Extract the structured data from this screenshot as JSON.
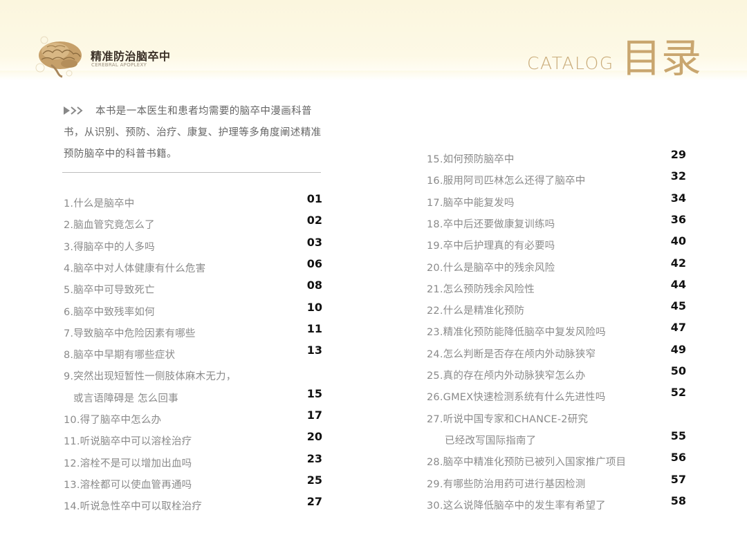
{
  "header": {
    "brand_title": "精准防治脑卒中",
    "brand_subtitle": "CEREBRAL APOPLEXY",
    "catalog_en": "CATALOG",
    "catalog_cn": "目录"
  },
  "intro": {
    "text": "本书是一本医生和患者均需要的脑卒中漫画科普书，从识别、预防、治疗、康复、护理等多角度阐述精准预防脑卒中的科普书籍。"
  },
  "toc_left": [
    {
      "title": "1.什么是脑卒中",
      "page": "01"
    },
    {
      "title": "2.脑血管究竟怎么了",
      "page": "02"
    },
    {
      "title": "3.得脑卒中的人多吗",
      "page": "03"
    },
    {
      "title": "4.脑卒中对人体健康有什么危害",
      "page": "06"
    },
    {
      "title": "5.脑卒中可导致死亡",
      "page": "08"
    },
    {
      "title": "6.脑卒中致残率如何",
      "page": "10"
    },
    {
      "title": "7.导致脑卒中危险因素有哪些",
      "page": "11"
    },
    {
      "title": "8.脑卒中早期有哪些症状",
      "page": "13"
    },
    {
      "title": "9.突然出现短暂性一侧肢体麻木无力，",
      "title2": "或言语障碍是 怎么回事",
      "page": "15"
    },
    {
      "title": "10.得了脑卒中怎么办",
      "page": "17"
    },
    {
      "title": "11.听说脑卒中可以溶栓治疗",
      "page": "20"
    },
    {
      "title": "12.溶栓不是可以增加出血吗",
      "page": "23"
    },
    {
      "title": "13.溶栓都可以使血管再通吗",
      "page": "25"
    },
    {
      "title": "14.听说急性卒中可以取栓治疗",
      "page": "27"
    }
  ],
  "toc_right": [
    {
      "title": "15.如何预防脑卒中",
      "page": "29"
    },
    {
      "title": "16.服用阿司匹林怎么还得了脑卒中",
      "page": "32"
    },
    {
      "title": "17.脑卒中能复发吗",
      "page": "34"
    },
    {
      "title": "18.卒中后还要做康复训练吗",
      "page": "36"
    },
    {
      "title": "19.卒中后护理真的有必要吗",
      "page": "40"
    },
    {
      "title": "20.什么是脑卒中的残余风险",
      "page": "42"
    },
    {
      "title": "21.怎么预防残余风险性",
      "page": "44"
    },
    {
      "title": "22.什么是精准化预防",
      "page": "45"
    },
    {
      "title": "23.精准化预防能降低脑卒中复发风险吗",
      "page": "47"
    },
    {
      "title": "24.怎么判断是否存在颅内外动脉狭窄",
      "page": "49"
    },
    {
      "title": "25.真的存在颅内外动脉狭窄怎么办",
      "page": "50"
    },
    {
      "title": "26.GMEX快速检测系统有什么先进性吗",
      "page": "52"
    },
    {
      "title": "27.听说中国专家和CHANCE-2研究",
      "title2": "已经改写国际指南了",
      "page": "55"
    },
    {
      "title": "28.脑卒中精准化预防已被列入国家推广项目",
      "page": "56"
    },
    {
      "title": "29.有哪些防治用药可进行基因检测",
      "page": "57"
    },
    {
      "title": "30.这么说降低脑卒中的发生率有希望了",
      "page": "58"
    }
  ]
}
